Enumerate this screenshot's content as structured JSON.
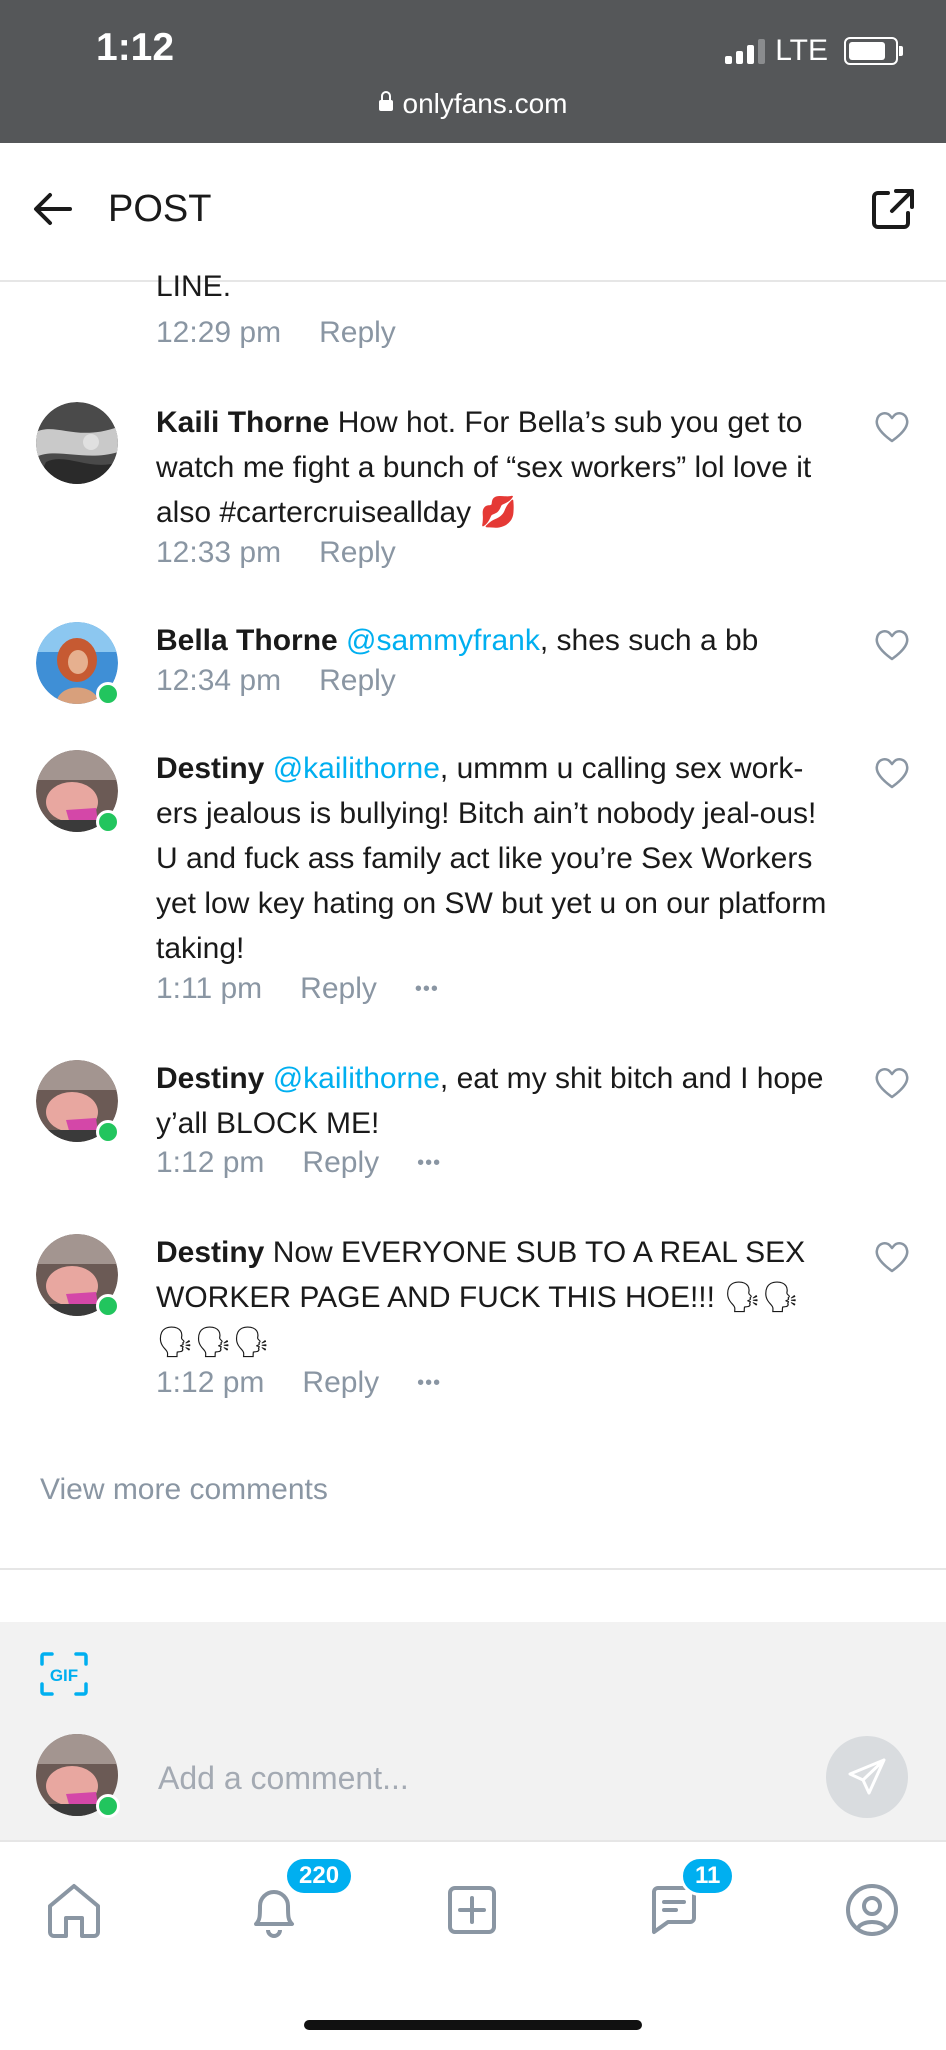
{
  "status": {
    "time": "1:12",
    "network": "LTE",
    "url": "onlyfans.com"
  },
  "header": {
    "title": "POST"
  },
  "feed": {
    "partial_text": "LINE.",
    "partial_time": "12:29 pm",
    "reply_label": "Reply",
    "more_label": "•••",
    "comments": [
      {
        "name": "Kaili Thorne",
        "text": " How hot. For Bella’s sub you get to watch me fight a bunch of “sex workers” lol love it also #cartercruiseallday 💋",
        "time": "12:33 pm"
      },
      {
        "name": "Bella Thorne",
        "mention": "@sammyfrank",
        "text": ", shes such a bb",
        "time": "12:34 pm"
      },
      {
        "name": "Destiny",
        "mention": "@kailithorne",
        "text": ", ummm u calling sex work-ers jealous is bullying! Bitch ain’t nobody jeal-ous! U and fuck ass family act like you’re Sex Workers yet low key hating on SW but yet u on our platform taking!",
        "time": "1:11 pm"
      },
      {
        "name": "Destiny",
        "mention": "@kailithorne",
        "text": ", eat my shit bitch and I hope y’all BLOCK ME!",
        "time": "1:12 pm"
      },
      {
        "name": "Destiny",
        "text": " Now EVERYONE SUB TO A REAL SEX WORKER PAGE AND FUCK THIS HOE!!! 🗣🗣 🗣🗣🗣",
        "time": "1:12 pm"
      }
    ],
    "view_more": "View more comments"
  },
  "composer": {
    "gif_label": "GIF",
    "placeholder": "Add a comment..."
  },
  "tabbar": {
    "notifications_count": "220",
    "messages_count": "11"
  },
  "colors": {
    "accent": "#00aff0",
    "online": "#22c55e",
    "muted": "#8a96a3"
  }
}
